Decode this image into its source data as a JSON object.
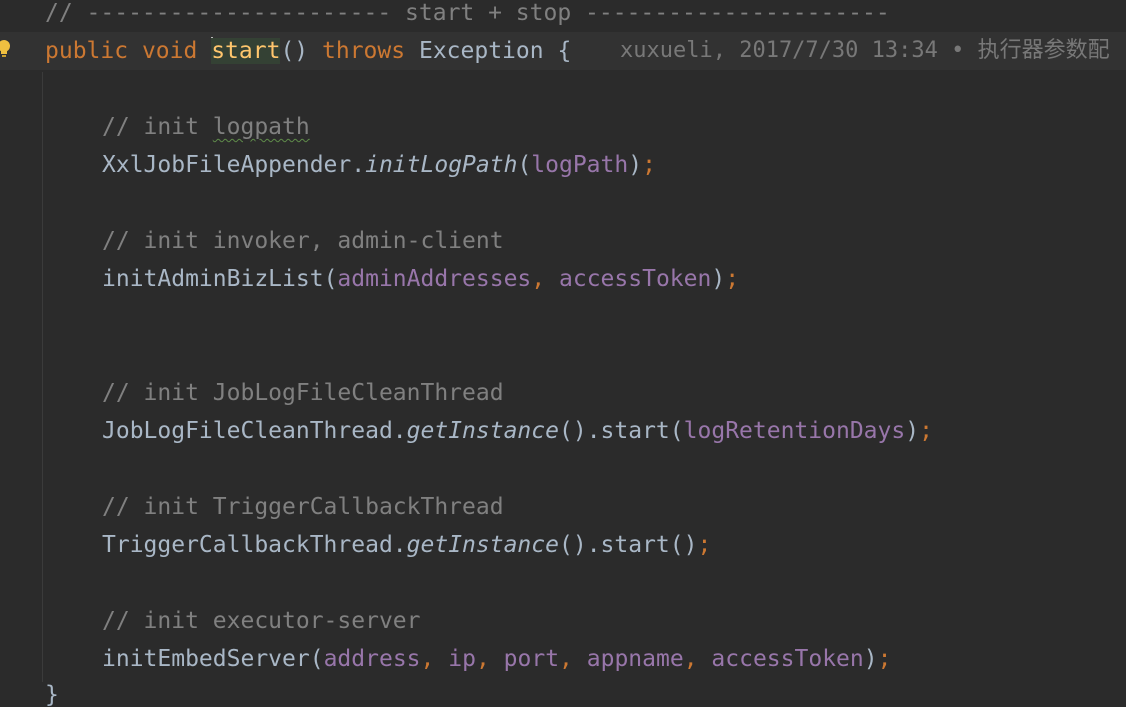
{
  "editor": {
    "colors": {
      "background": "#2b2b2b",
      "current_line": "#323232",
      "comment": "#808080",
      "keyword": "#cc7832",
      "field": "#9876aa",
      "method_decl": "#ffc66d",
      "plain": "#a9b7c6"
    },
    "gutter_icon": "lightbulb-icon",
    "line0": {
      "comment": "// ---------------------- start + stop ----------------------"
    },
    "line1": {
      "public": "public",
      "void": "void",
      "method_name": "start",
      "parens": "()",
      "throws": "throws",
      "exception": "Exception",
      "brace": "{",
      "blame": "xuxueli, 2017/7/30 13:34 • 执行器参数配"
    },
    "line2": {
      "comment_prefix": "// init ",
      "comment_word": "logpath"
    },
    "line3": {
      "class_name": "XxlJobFileAppender",
      "dot": ".",
      "method": "initLogPath",
      "open": "(",
      "arg1": "logPath",
      "close": ")",
      "semi": ";"
    },
    "line4": {
      "comment": "// init invoker, admin-client"
    },
    "line5": {
      "method": "initAdminBizList",
      "open": "(",
      "arg1": "adminAddresses",
      "comma1": ",",
      "arg2": "accessToken",
      "close": ")",
      "semi": ";"
    },
    "line6": {
      "comment": "// init JobLogFileCleanThread"
    },
    "line7": {
      "class_name": "JobLogFileCleanThread",
      "dot1": ".",
      "method1": "getInstance",
      "call1": "()",
      "dot2": ".",
      "method2": "start",
      "open": "(",
      "arg1": "logRetentionDays",
      "close": ")",
      "semi": ";"
    },
    "line8": {
      "comment": "// init TriggerCallbackThread"
    },
    "line9": {
      "class_name": "TriggerCallbackThread",
      "dot1": ".",
      "method1": "getInstance",
      "call1": "()",
      "dot2": ".",
      "method2": "start",
      "call2": "()",
      "semi": ";"
    },
    "line10": {
      "comment": "// init executor-server"
    },
    "line11": {
      "method": "initEmbedServer",
      "open": "(",
      "arg1": "address",
      "comma1": ",",
      "arg2": "ip",
      "comma2": ",",
      "arg3": "port",
      "comma3": ",",
      "arg4": "appname",
      "comma4": ",",
      "arg5": "accessToken",
      "close": ")",
      "semi": ";"
    },
    "line12": {
      "brace": "}"
    }
  }
}
